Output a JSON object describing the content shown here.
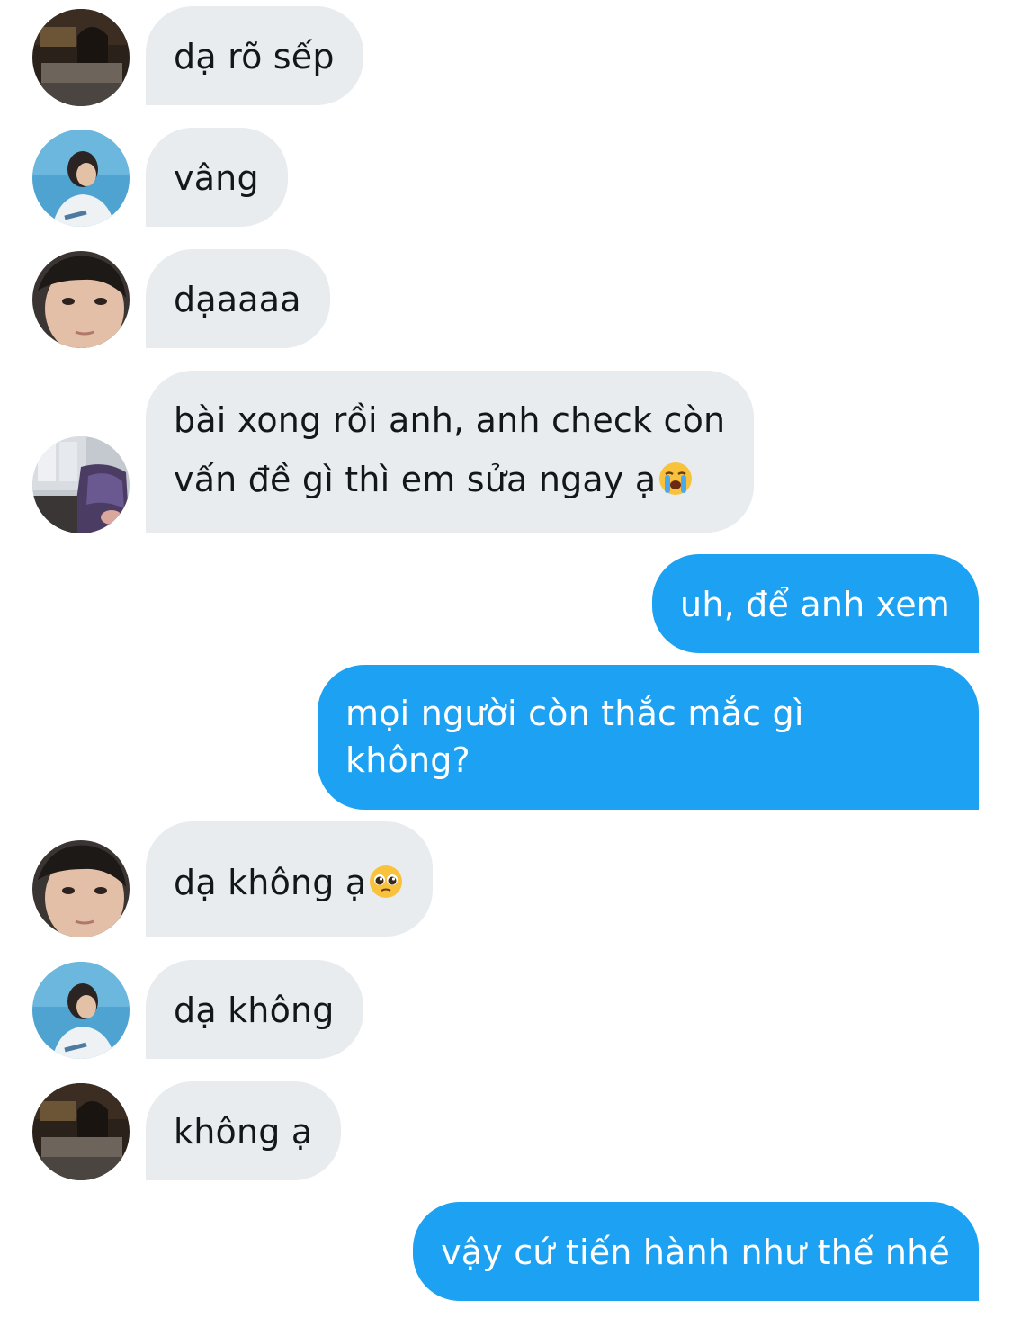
{
  "chat": {
    "messages": [
      {
        "direction": "incoming",
        "avatar": "avatar-dark-bedroom",
        "text": "dạ rõ sếp"
      },
      {
        "direction": "incoming",
        "avatar": "avatar-blue-sky",
        "text": "vâng"
      },
      {
        "direction": "incoming",
        "avatar": "avatar-face-closeup",
        "text": "dạaaaa"
      },
      {
        "direction": "incoming",
        "avatar": "avatar-purple-room",
        "text": "bài xong rồi anh, anh check còn\nvấn đề gì thì em sửa ngay ạ",
        "emoji": "loudly-crying-face-emoji"
      },
      {
        "direction": "outgoing",
        "text": "uh, để anh xem"
      },
      {
        "direction": "outgoing",
        "text": "mọi người còn thắc mắc gì\nkhông?"
      },
      {
        "direction": "incoming",
        "avatar": "avatar-face-closeup",
        "text": "dạ không ạ",
        "emoji": "pleading-face-emoji"
      },
      {
        "direction": "incoming",
        "avatar": "avatar-blue-sky",
        "text": "dạ không"
      },
      {
        "direction": "incoming",
        "avatar": "avatar-dark-bedroom",
        "text": "không ạ"
      },
      {
        "direction": "outgoing",
        "text": "vậy cứ tiến hành như thế nhé"
      }
    ]
  },
  "colors": {
    "incoming_bubble": "#e8ecef",
    "incoming_text": "#14171a",
    "outgoing_bubble": "#1da1f2",
    "outgoing_text": "#ffffff",
    "background": "#ffffff"
  }
}
